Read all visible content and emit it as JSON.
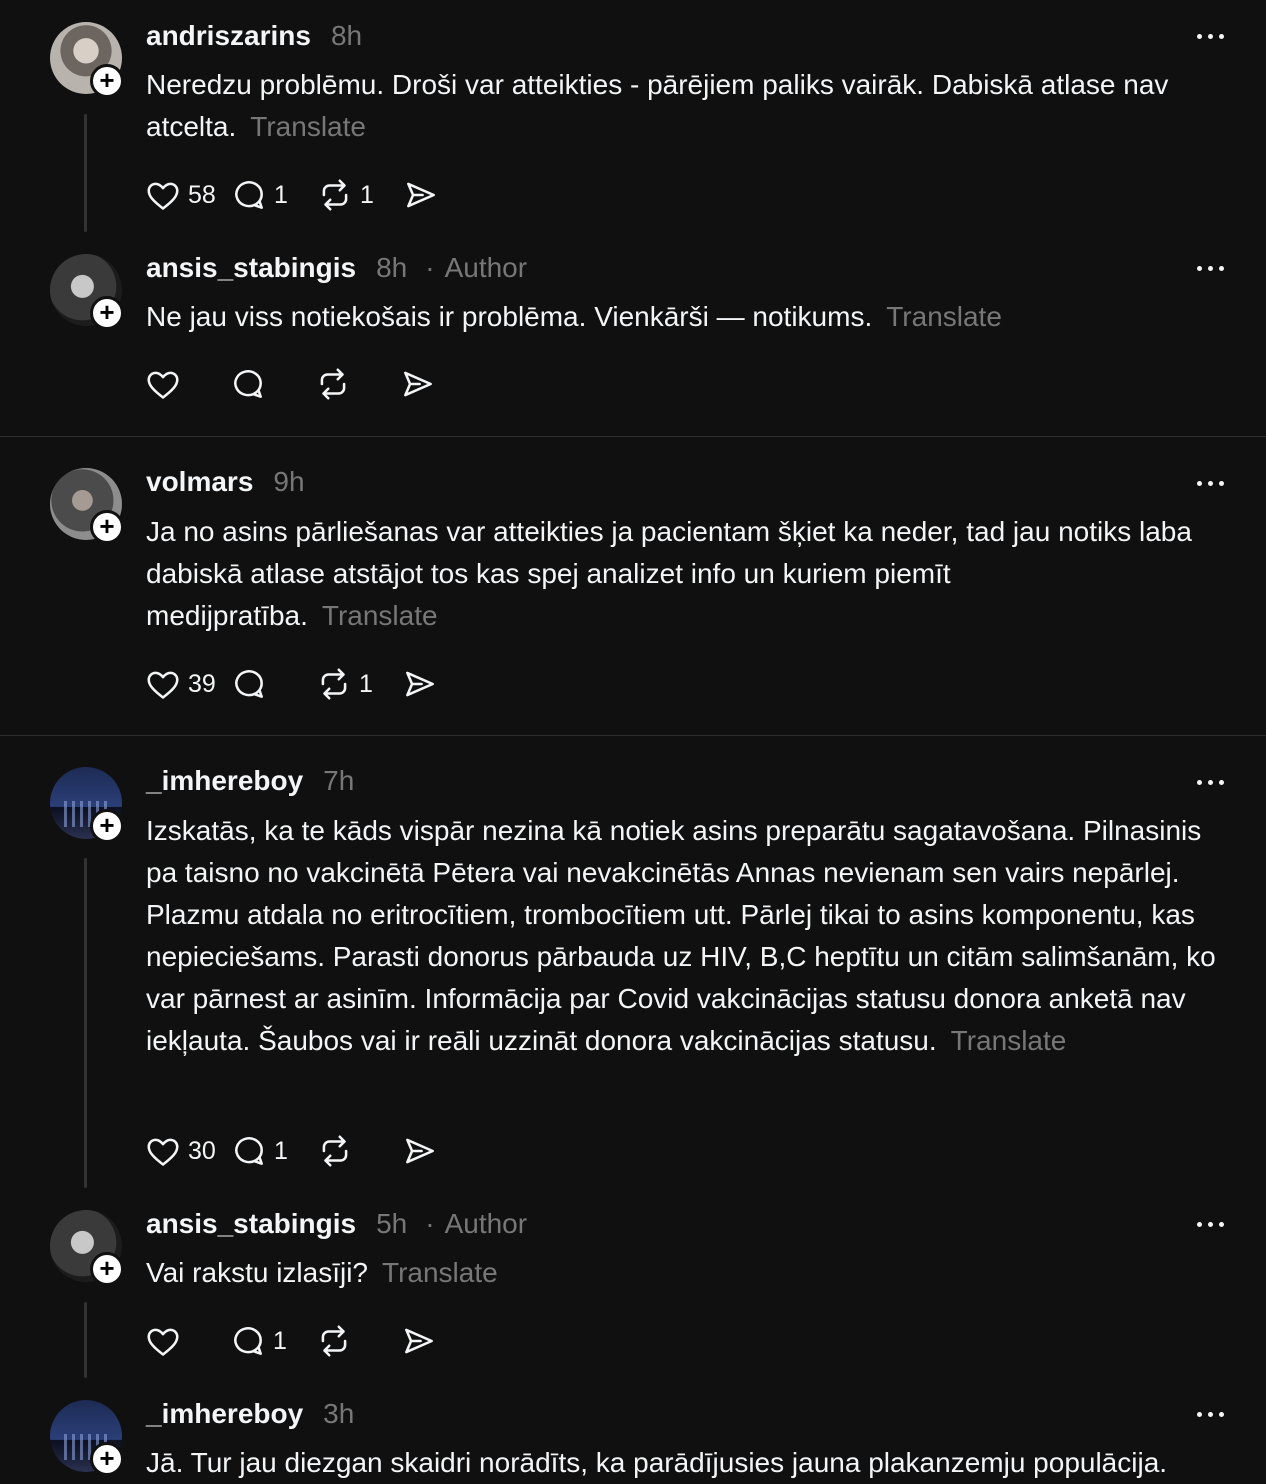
{
  "translate_label": "Translate",
  "author_label": "Author",
  "posts": [
    {
      "username": "andriszarins",
      "time": "8h",
      "author": "",
      "text": "Neredzu problēmu. Droši var atteikties - pārējiem paliks vairāk. Dabiskā atlase nav atcelta.",
      "likes": "58",
      "replies": "1",
      "reposts": "1"
    },
    {
      "username": "ansis_stabingis",
      "time": "8h",
      "author": "Author",
      "text": "Ne jau viss notiekošais ir problēma. Vienkārši — notikums.",
      "likes": "",
      "replies": "",
      "reposts": ""
    },
    {
      "username": "volmars",
      "time": "9h",
      "author": "",
      "text": "Ja no asins pārliešanas var atteikties ja pacientam šķiet ka neder, tad jau notiks laba dabiskā atlase atstājot tos kas spej analizet info un kuriem piemīt medijpratība.",
      "likes": "39",
      "replies": "",
      "reposts": "1"
    },
    {
      "username": "_imhereboy",
      "time": "7h",
      "author": "",
      "text": "Izskatās, ka te kāds vispār nezina kā notiek asins preparātu sagatavošana. Pilnasinis pa taisno no vakcinētā Pētera vai nevakcinētās Annas nevienam sen vairs nepārlej. Plazmu atdala no eritrocītiem, trombocītiem utt. Pārlej tikai to asins komponentu, kas nepieciešams. Parasti donorus pārbauda uz HIV, B,C heptītu un citām salimšanām, ko var pārnest ar asinīm. Informācija par Covid vakcinācijas statusu donora anketā nav iekļauta. Šaubos vai ir reāli uzzināt donora vakcinācijas statusu.",
      "likes": "30",
      "replies": "1",
      "reposts": ""
    },
    {
      "username": "ansis_stabingis",
      "time": "5h",
      "author": "Author",
      "text": "Vai rakstu izlasīji?",
      "likes": "",
      "replies": "1",
      "reposts": ""
    },
    {
      "username": "_imhereboy",
      "time": "3h",
      "author": "",
      "text": "Jā. Tur jau diezgan skaidri norādīts, ka parādījusies jauna plakanzemju populācija.",
      "likes": "",
      "replies": "",
      "reposts": ""
    }
  ]
}
